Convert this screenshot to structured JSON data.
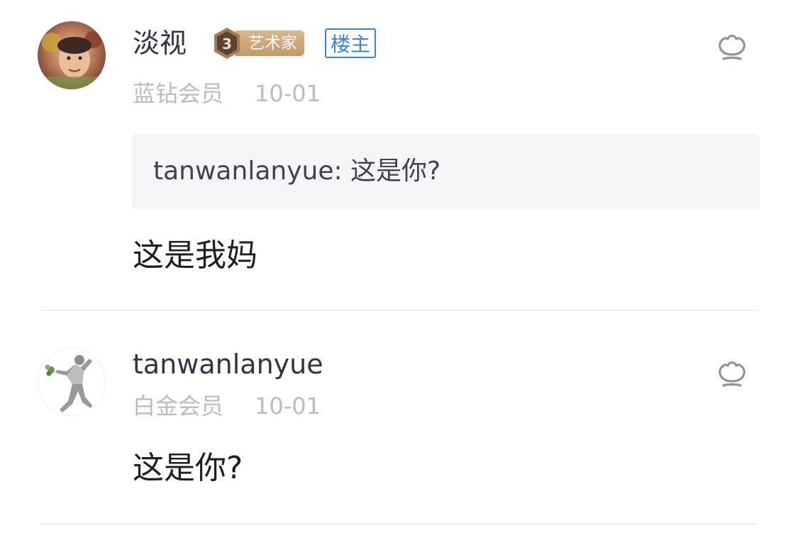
{
  "comments": [
    {
      "username": "淡视",
      "level_number": "3",
      "level_title": "艺术家",
      "owner_badge": "楼主",
      "member_level": "蓝钻会员",
      "date": "10-01",
      "quote": "tanwanlanyue: 这是你?",
      "content": "这是我妈",
      "like_icon": "like-icon"
    },
    {
      "username": "tanwanlanyue",
      "member_level": "白金会员",
      "date": "10-01",
      "content": "这是你?",
      "like_icon": "like-icon"
    }
  ],
  "colors": {
    "owner_badge": "#3f7fe0",
    "level_tag": "#c49a68",
    "meta_text": "#b9bcc4",
    "username_text": "#2f3447"
  }
}
